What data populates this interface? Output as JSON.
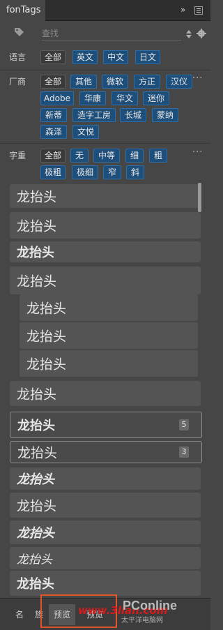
{
  "panel": {
    "title": "fonTags"
  },
  "search": {
    "placeholder": "查找"
  },
  "language": {
    "label": "语言",
    "chips": [
      "全部",
      "英文",
      "中文",
      "日文"
    ]
  },
  "vendor": {
    "label": "厂商",
    "chips": [
      "全部",
      "其他",
      "微软",
      "方正",
      "汉仪",
      "Adobe",
      "华康",
      "华文",
      "迷你",
      "新蒂",
      "造字工房",
      "长城",
      "蒙纳",
      "森泽",
      "文悦"
    ]
  },
  "weight": {
    "label": "字重",
    "chips": [
      "全部",
      "无",
      "中等",
      "细",
      "粗",
      "极粗",
      "极细",
      "窄",
      "斜"
    ]
  },
  "more_label": "···",
  "preview": {
    "items": [
      {
        "text": "龙抬头",
        "badge": ""
      },
      {
        "text": "龙抬头",
        "badge": ""
      },
      {
        "text": "龙抬头",
        "badge": ""
      },
      {
        "text": "龙抬头",
        "badge": ""
      },
      {
        "text": "龙抬头",
        "badge": ""
      },
      {
        "text": "龙抬头",
        "badge": ""
      },
      {
        "text": "龙抬头",
        "badge": ""
      },
      {
        "text": "龙抬头",
        "badge": ""
      },
      {
        "text": "龙抬头",
        "badge": "5"
      },
      {
        "text": "龙抬头",
        "badge": "3"
      },
      {
        "text": "龙抬头",
        "badge": ""
      },
      {
        "text": "龙抬头",
        "badge": ""
      },
      {
        "text": "龙抬头",
        "badge": ""
      },
      {
        "text": "龙抬头",
        "badge": ""
      },
      {
        "text": "龙抬头",
        "badge": ""
      }
    ]
  },
  "bottom_tabs": [
    "名",
    "族",
    "预览",
    "预览"
  ],
  "watermark": {
    "site": "www.3lian.com",
    "brand": "PConline",
    "sub": "太平洋电脑网"
  },
  "colors": {
    "chip_blue": "#1e4e7a",
    "highlight": "#e0562a"
  }
}
